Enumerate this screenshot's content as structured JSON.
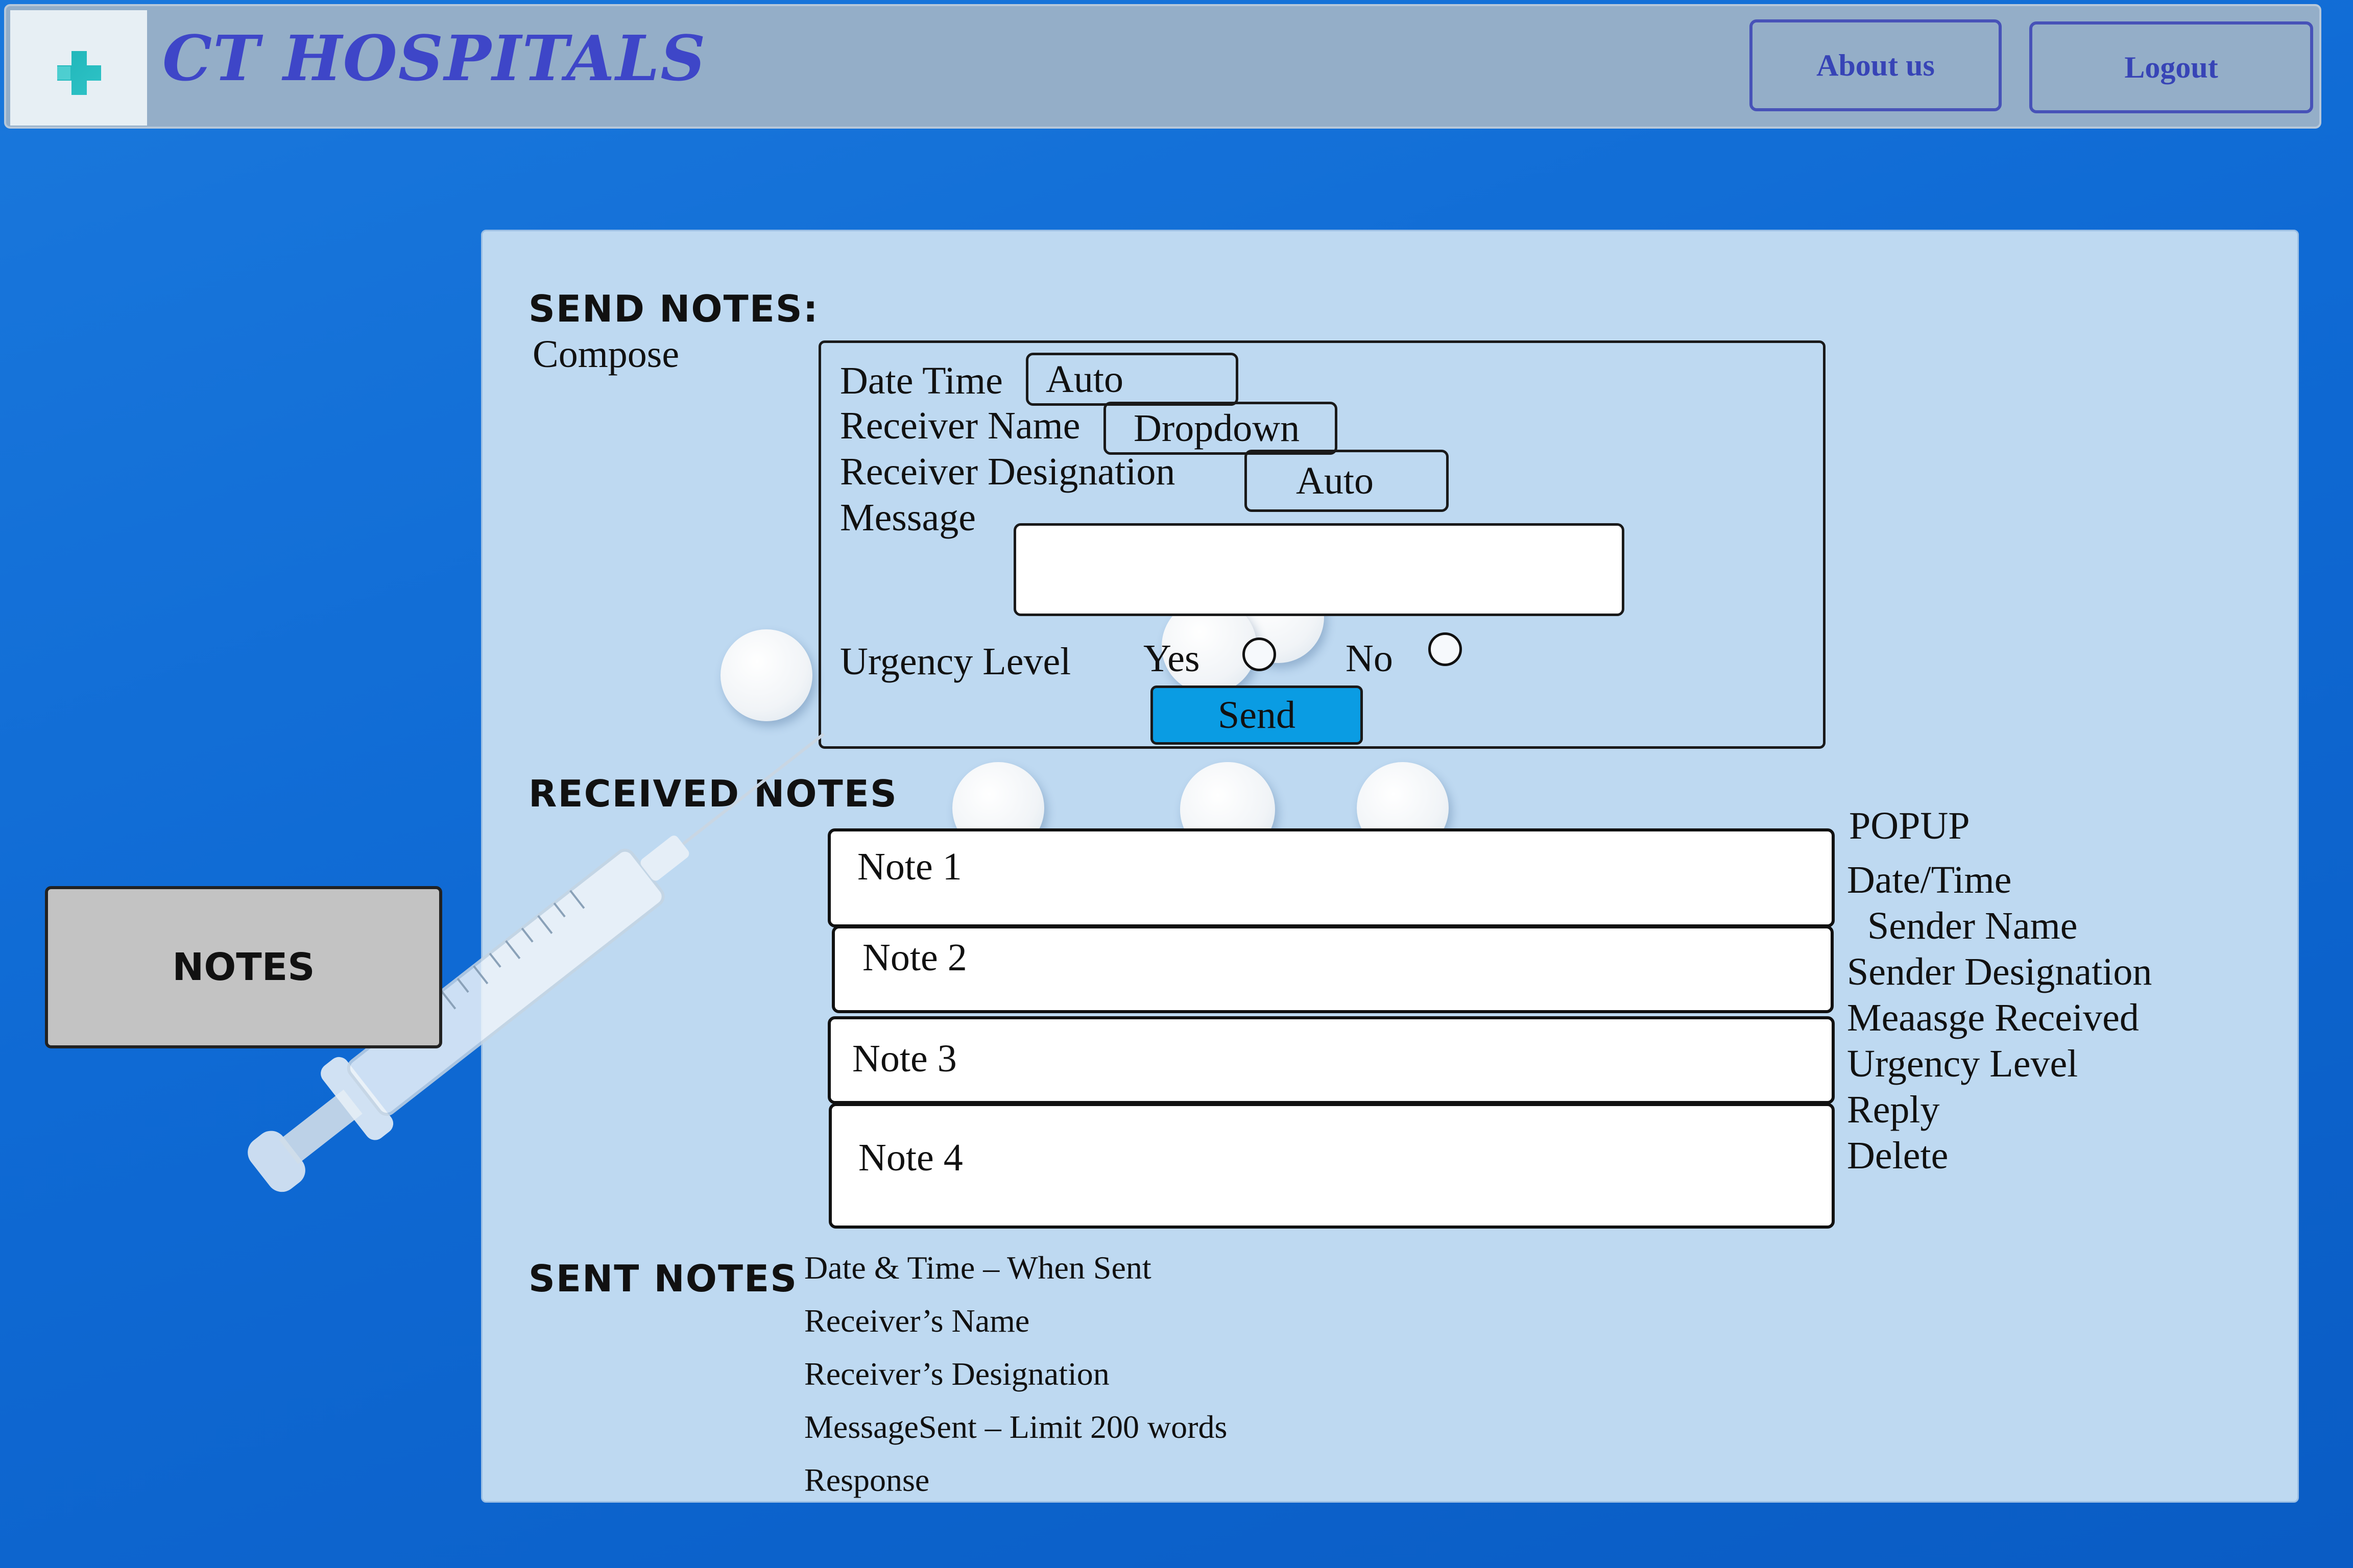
{
  "header": {
    "title": "CT HOSPITALS",
    "about_label": "About us",
    "logout_label": "Logout",
    "logo_icon": "medical-cross-icon"
  },
  "sidebar": {
    "notes_label": "NOTES"
  },
  "send_notes": {
    "heading": "SEND NOTES:",
    "compose_label": "Compose",
    "date_time_label": "Date Time",
    "date_time_value": "Auto",
    "receiver_name_label": "Receiver Name",
    "receiver_name_value": "Dropdown",
    "receiver_designation_label": "Receiver Designation",
    "receiver_designation_value": "Auto",
    "message_label": "Message",
    "message_value": "",
    "urgency_label": "Urgency Level",
    "yes_label": "Yes",
    "no_label": "No",
    "send_label": "Send"
  },
  "received_notes": {
    "heading": "RECEIVED NOTES",
    "notes": [
      "Note 1",
      "Note 2",
      "Note 3",
      "Note 4"
    ]
  },
  "popup": {
    "title": "POPUP",
    "items": [
      "Date/Time",
      "Sender Name",
      "Sender Designation",
      "Meaasge Received",
      "Urgency Level",
      "Reply",
      "Delete"
    ]
  },
  "sent_notes": {
    "heading": "SENT NOTES",
    "items": [
      "Date & Time – When Sent",
      "Receiver’s Name",
      "Receiver’s Designation",
      "MessageSent – Limit 200 words",
      "Response"
    ]
  },
  "colors": {
    "background": "#0f6ad4",
    "header": "#94aec8",
    "panel": "#bed9f1",
    "accent_text": "#3e46c8",
    "send_button": "#0a9ce3",
    "notes_button": "#c3c3c3"
  }
}
